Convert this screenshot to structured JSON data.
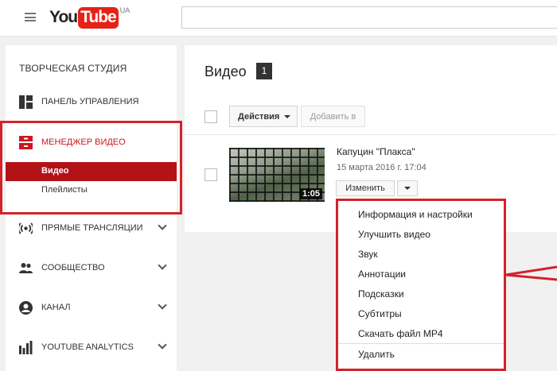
{
  "header": {
    "logo_you": "You",
    "logo_tube": "Tube",
    "logo_country": "UA"
  },
  "sidebar": {
    "title": "ТВОРЧЕСКАЯ СТУДИЯ",
    "items": [
      {
        "label": "ПАНЕЛЬ УПРАВЛЕНИЯ",
        "icon": "dashboard-icon"
      },
      {
        "label": "МЕНЕДЖЕР ВИДЕО",
        "icon": "video-manager-icon"
      },
      {
        "label": "ПРЯМЫЕ ТРАНСЛЯЦИИ",
        "icon": "live-broadcast-icon"
      },
      {
        "label": "СООБЩЕСТВО",
        "icon": "community-icon"
      },
      {
        "label": "КАНАЛ",
        "icon": "channel-icon"
      },
      {
        "label": "YOUTUBE ANALYTICS",
        "icon": "analytics-icon"
      }
    ],
    "subitems": [
      {
        "label": "Видео"
      },
      {
        "label": "Плейлисты"
      }
    ]
  },
  "main": {
    "title": "Видео",
    "count": "1",
    "actions_label": "Действия",
    "add_to_label": "Добавить в",
    "video": {
      "title": "Капуцин \"Плакса\"",
      "date": "15 марта 2016 г. 17:04",
      "duration": "1:05",
      "edit_label": "Изменить"
    }
  },
  "dropdown": {
    "items": [
      {
        "label": "Информация и настройки"
      },
      {
        "label": "Улучшить видео"
      },
      {
        "label": "Звук"
      },
      {
        "label": "Аннотации"
      },
      {
        "label": "Подсказки"
      },
      {
        "label": "Субтитры"
      },
      {
        "label": "Скачать файл MP4"
      },
      {
        "label": "Удалить"
      }
    ]
  },
  "colors": {
    "accent_red": "#d2232a",
    "brand_red": "#e62117",
    "selected_bg": "#b31217"
  }
}
